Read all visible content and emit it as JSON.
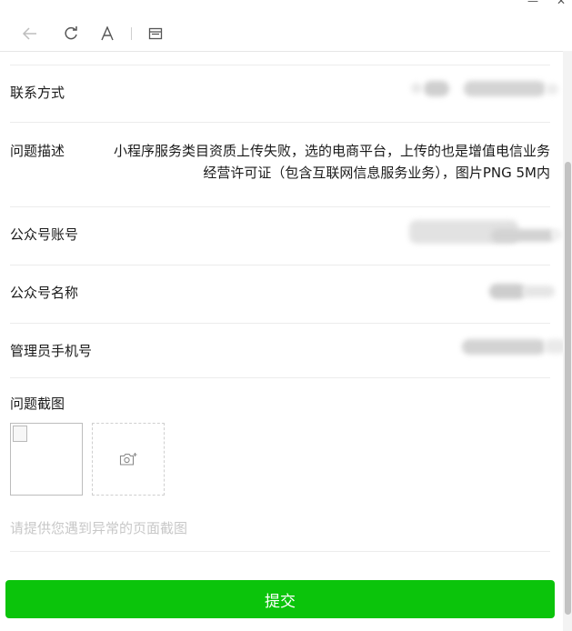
{
  "form": {
    "rows": {
      "contact": {
        "label": "联系方式"
      },
      "description": {
        "label": "问题描述",
        "value": "小程序服务类目资质上传失败，选的电商平台，上传的也是增值电信业务经营许可证（包含互联网信息服务业务），图片PNG 5M内"
      },
      "account": {
        "label": "公众号账号"
      },
      "name": {
        "label": "公众号名称"
      },
      "admin_phone": {
        "label": "管理员手机号"
      }
    },
    "screenshot": {
      "label": "问题截图",
      "hint": "请提供您遇到异常的页面截图"
    },
    "submit_label": "提交"
  },
  "colors": {
    "accent": "#0bc40b",
    "hint": "#c8c8c8",
    "divider": "#ececec"
  }
}
